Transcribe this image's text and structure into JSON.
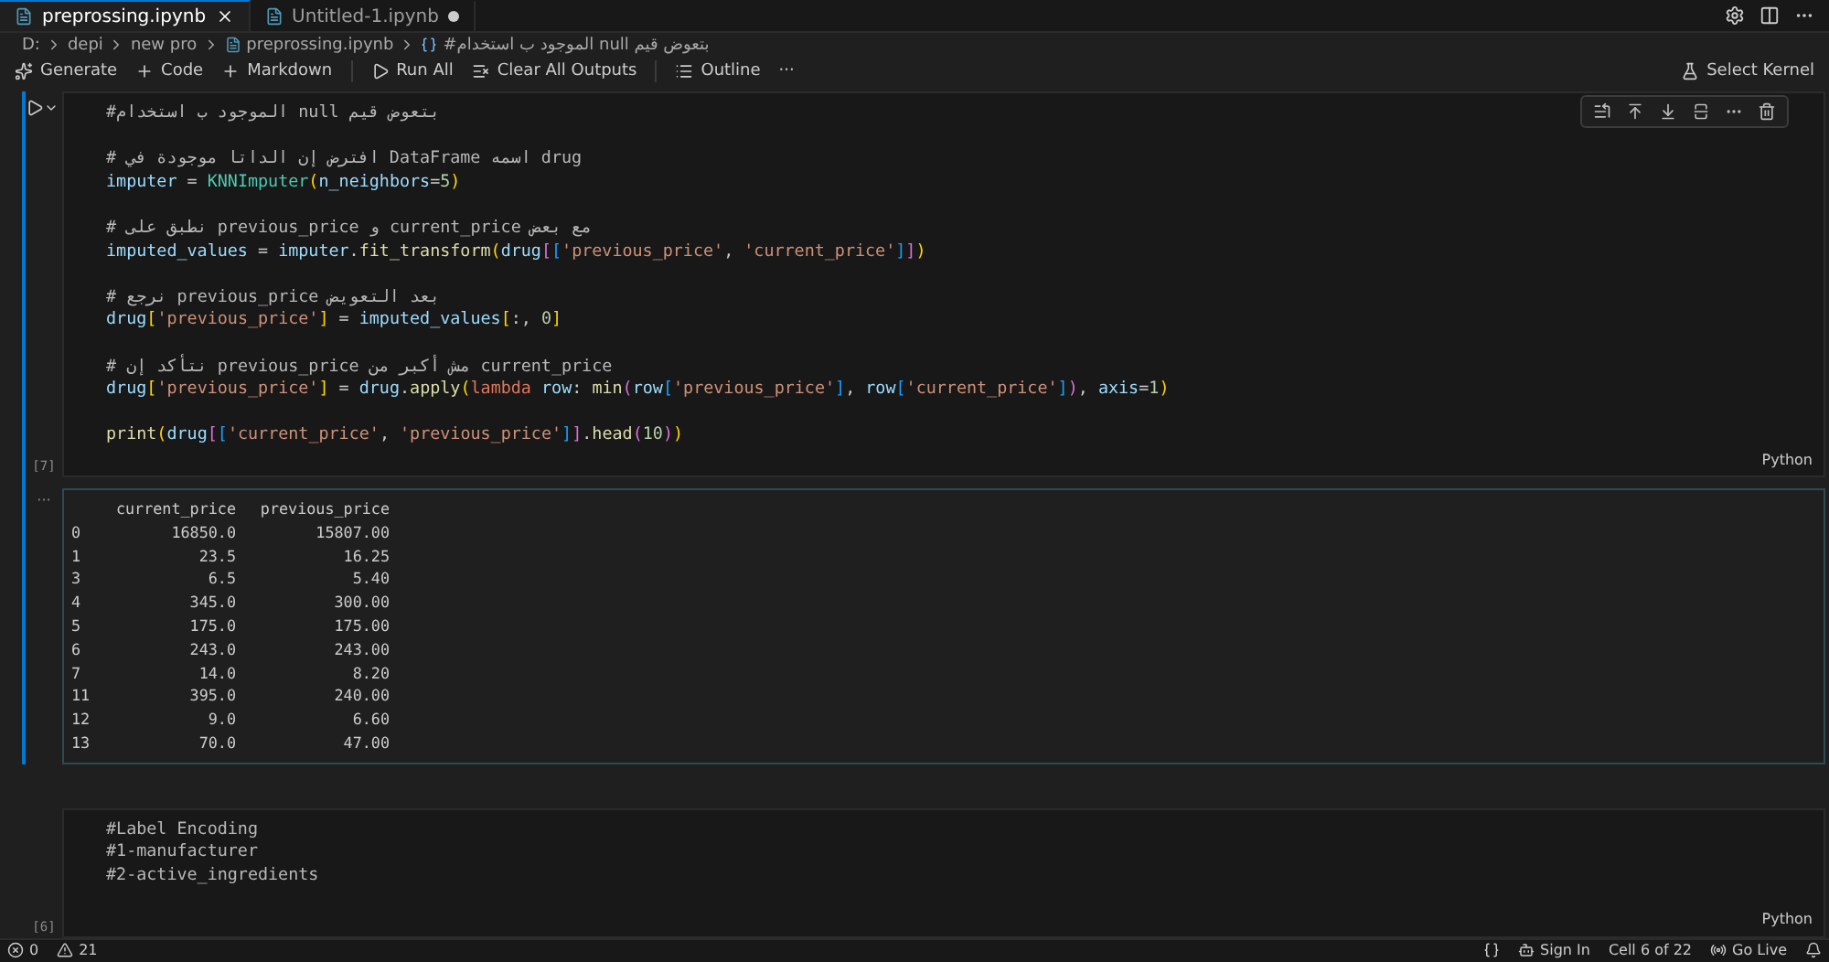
{
  "tabs": [
    {
      "label": "preprossing.ipynb",
      "selected": true,
      "dirty": false
    },
    {
      "label": "Untitled-1.ipynb",
      "selected": false,
      "dirty": true
    }
  ],
  "breadcrumb": [
    "D:",
    "depi",
    "new pro",
    "preprossing.ipynb",
    "#الموجود ب استخدام null بتعوض قيم"
  ],
  "toolbar": [
    {
      "kind": "sparkle",
      "label": "Generate"
    },
    {
      "kind": "plus",
      "label": "Code"
    },
    {
      "kind": "plus",
      "label": "Markdown"
    },
    {
      "kind": "run",
      "label": "Run All"
    },
    {
      "kind": "clear",
      "label": "Clear All Outputs"
    },
    {
      "kind": "outline",
      "label": "Outline"
    },
    {
      "kind": "more",
      "label": "···"
    }
  ],
  "kernel": "Select Kernel",
  "cells": [
    {
      "count": "[7]",
      "language": "Python",
      "focused": true,
      "blocks": [
        [
          [
            {
              "kind": "comment",
              "t": "#الموجود ب استخدام null بتعوض قيم"
            }
          ]
        ],
        [
          [
            {
              "kind": "comment",
              "t": "# افترض إن الداتا موجودة في DataFrame اسمه drug"
            }
          ],
          [
            {
              "kind": "var",
              "t": "imputer"
            },
            {
              "kind": "plain",
              "t": " = "
            },
            {
              "kind": "cls",
              "t": "KNNImputer"
            },
            {
              "kind": "b1",
              "t": "("
            },
            {
              "kind": "param",
              "t": "n_neighbors"
            },
            {
              "kind": "plain",
              "t": "="
            },
            {
              "kind": "num",
              "t": "5"
            },
            {
              "kind": "b1",
              "t": ")"
            }
          ]
        ],
        [
          [
            {
              "kind": "comment",
              "t": "# نطبق على previous_price و current_price مع بعض"
            }
          ],
          [
            {
              "kind": "var",
              "t": "imputed_values"
            },
            {
              "kind": "plain",
              "t": " = "
            },
            {
              "kind": "var",
              "t": "imputer"
            },
            {
              "kind": "plain",
              "t": "."
            },
            {
              "kind": "func",
              "t": "fit_transform"
            },
            {
              "kind": "b1",
              "t": "("
            },
            {
              "kind": "var",
              "t": "drug"
            },
            {
              "kind": "b2",
              "t": "["
            },
            {
              "kind": "b3",
              "t": "["
            },
            {
              "kind": "str",
              "t": "'previous_price'"
            },
            {
              "kind": "plain",
              "t": ", "
            },
            {
              "kind": "str",
              "t": "'current_price'"
            },
            {
              "kind": "b3",
              "t": "]"
            },
            {
              "kind": "b2",
              "t": "]"
            },
            {
              "kind": "b1",
              "t": ")"
            }
          ]
        ],
        [
          [
            {
              "kind": "comment",
              "t": "# نرجع previous_price بعد التعويض"
            }
          ],
          [
            {
              "kind": "var",
              "t": "drug"
            },
            {
              "kind": "b1",
              "t": "["
            },
            {
              "kind": "str",
              "t": "'previous_price'"
            },
            {
              "kind": "b1",
              "t": "]"
            },
            {
              "kind": "plain",
              "t": " = "
            },
            {
              "kind": "var",
              "t": "imputed_values"
            },
            {
              "kind": "b1",
              "t": "["
            },
            {
              "kind": "plain",
              "t": ":, "
            },
            {
              "kind": "num",
              "t": "0"
            },
            {
              "kind": "b1",
              "t": "]"
            }
          ]
        ],
        [
          [
            {
              "kind": "comment",
              "t": "# نتأكد إن previous_price مش أكبر من current_price"
            }
          ],
          [
            {
              "kind": "var",
              "t": "drug"
            },
            {
              "kind": "b1",
              "t": "["
            },
            {
              "kind": "str",
              "t": "'previous_price'"
            },
            {
              "kind": "b1",
              "t": "]"
            },
            {
              "kind": "plain",
              "t": " = "
            },
            {
              "kind": "var",
              "t": "drug"
            },
            {
              "kind": "plain",
              "t": "."
            },
            {
              "kind": "func",
              "t": "apply"
            },
            {
              "kind": "b1",
              "t": "("
            },
            {
              "kind": "kw",
              "t": "lambda"
            },
            {
              "kind": "param",
              "t": " row"
            },
            {
              "kind": "plain",
              "t": ": "
            },
            {
              "kind": "func",
              "t": "min"
            },
            {
              "kind": "b2",
              "t": "("
            },
            {
              "kind": "var",
              "t": "row"
            },
            {
              "kind": "b3",
              "t": "["
            },
            {
              "kind": "str",
              "t": "'previous_price'"
            },
            {
              "kind": "b3",
              "t": "]"
            },
            {
              "kind": "plain",
              "t": ", "
            },
            {
              "kind": "var",
              "t": "row"
            },
            {
              "kind": "b3",
              "t": "["
            },
            {
              "kind": "str",
              "t": "'current_price'"
            },
            {
              "kind": "b3",
              "t": "]"
            },
            {
              "kind": "b2",
              "t": ")"
            },
            {
              "kind": "plain",
              "t": ", "
            },
            {
              "kind": "param",
              "t": "axis"
            },
            {
              "kind": "plain",
              "t": "="
            },
            {
              "kind": "num",
              "t": "1"
            },
            {
              "kind": "b1",
              "t": ")"
            }
          ]
        ],
        [
          [
            {
              "kind": "func",
              "t": "print"
            },
            {
              "kind": "b1",
              "t": "("
            },
            {
              "kind": "var",
              "t": "drug"
            },
            {
              "kind": "b2",
              "t": "["
            },
            {
              "kind": "b3",
              "t": "["
            },
            {
              "kind": "str",
              "t": "'current_price'"
            },
            {
              "kind": "plain",
              "t": ", "
            },
            {
              "kind": "str",
              "t": "'previous_price'"
            },
            {
              "kind": "b3",
              "t": "]"
            },
            {
              "kind": "b2",
              "t": "]"
            },
            {
              "kind": "plain",
              "t": "."
            },
            {
              "kind": "func",
              "t": "head"
            },
            {
              "kind": "b2",
              "t": "("
            },
            {
              "kind": "num",
              "t": "10"
            },
            {
              "kind": "b2",
              "t": ")"
            },
            {
              "kind": "b1",
              "t": ")"
            }
          ]
        ]
      ],
      "output": {
        "menu": "···",
        "columns": [
          "",
          "current_price",
          "previous_price"
        ],
        "rows": [
          [
            "0",
            "16850.0",
            "15807.00"
          ],
          [
            "1",
            "23.5",
            "16.25"
          ],
          [
            "3",
            "6.5",
            "5.40"
          ],
          [
            "4",
            "345.0",
            "300.00"
          ],
          [
            "5",
            "175.0",
            "175.00"
          ],
          [
            "6",
            "243.0",
            "243.00"
          ],
          [
            "7",
            "14.0",
            "8.20"
          ],
          [
            "11",
            "395.0",
            "240.00"
          ],
          [
            "12",
            "9.0",
            "6.60"
          ],
          [
            "13",
            "70.0",
            "47.00"
          ]
        ]
      }
    },
    {
      "count": "[6]",
      "language": "Python",
      "focused": false,
      "blocks": [
        [
          [
            {
              "kind": "comment",
              "t": "#Label Encoding"
            }
          ],
          [
            {
              "kind": "comment",
              "t": "#1-manufacturer"
            }
          ],
          [
            {
              "kind": "comment",
              "t": "#2-active_ingredients"
            }
          ]
        ]
      ]
    }
  ],
  "status_bar": {
    "errors": "0",
    "warnings": "21",
    "sign_in": "Sign In",
    "cell": "Cell 6 of 22",
    "live": "Go Live"
  }
}
